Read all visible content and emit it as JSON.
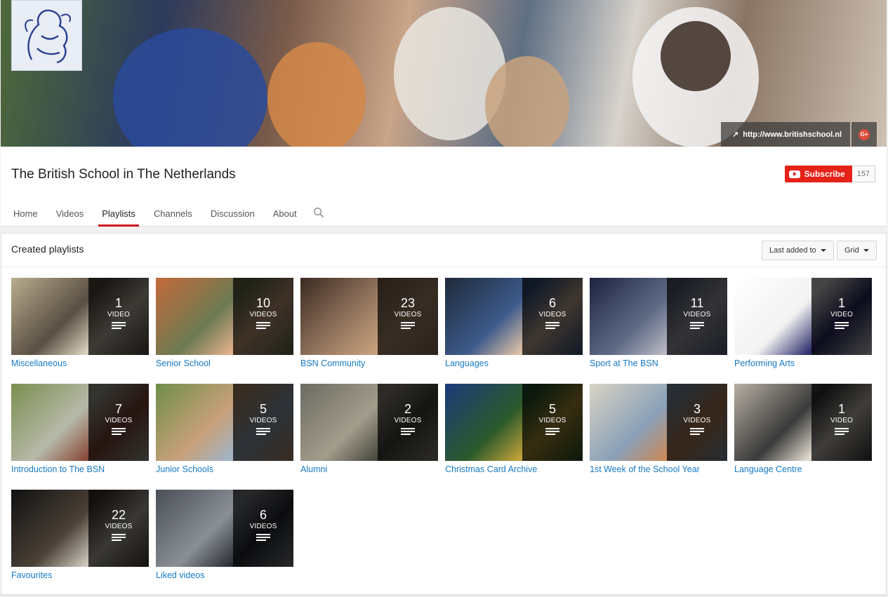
{
  "banner": {
    "website_link": "http://www.britishschool.nl",
    "social_icon": "google-plus-icon",
    "logo_icon": "lion-crest-logo"
  },
  "channel": {
    "title": "The British School in The Netherlands",
    "subscribe_label": "Subscribe",
    "subscriber_count": "157"
  },
  "tabs": [
    "Home",
    "Videos",
    "Playlists",
    "Channels",
    "Discussion",
    "About"
  ],
  "active_tab": "Playlists",
  "section": {
    "title": "Created playlists",
    "sort_label": "Last added to",
    "view_label": "Grid"
  },
  "playlists": [
    {
      "title": "Miscellaneous",
      "count": "1",
      "label": "VIDEO",
      "colors": [
        "#b9ad8e",
        "#5a4f43",
        "#d9d2bf"
      ]
    },
    {
      "title": "Senior School",
      "count": "10",
      "label": "VIDEOS",
      "colors": [
        "#c46a3a",
        "#6d7a52",
        "#e3b18d"
      ]
    },
    {
      "title": "BSN Community",
      "count": "23",
      "label": "VIDEOS",
      "colors": [
        "#3b2a22",
        "#9a7b62",
        "#c8a17e"
      ]
    },
    {
      "title": "Languages",
      "count": "6",
      "label": "VIDEOS",
      "colors": [
        "#1f2a3a",
        "#3c5a8a",
        "#e0c2a7"
      ]
    },
    {
      "title": "Sport at The BSN",
      "count": "11",
      "label": "VIDEOS",
      "colors": [
        "#1d2342",
        "#5f6b85",
        "#b8b8c4"
      ]
    },
    {
      "title": "Performing Arts",
      "count": "1",
      "label": "VIDEO",
      "colors": [
        "#ffffff",
        "#f2f2f2",
        "#2b2b6a"
      ]
    },
    {
      "title": "Introduction to The BSN",
      "count": "7",
      "label": "VIDEOS",
      "colors": [
        "#7b8f4e",
        "#b7b9aa",
        "#8a4a3a"
      ]
    },
    {
      "title": "Junior Schools",
      "count": "5",
      "label": "VIDEOS",
      "colors": [
        "#6f8e4a",
        "#c9a07a",
        "#9fb4c8"
      ]
    },
    {
      "title": "Alumni",
      "count": "2",
      "label": "VIDEOS",
      "colors": [
        "#6b6b60",
        "#a39c8c",
        "#4a4a40"
      ]
    },
    {
      "title": "Christmas Card Archive",
      "count": "5",
      "label": "VIDEOS",
      "colors": [
        "#1d3a7a",
        "#2b5a2b",
        "#c4a23a"
      ]
    },
    {
      "title": "1st Week of the School Year",
      "count": "3",
      "label": "VIDEOS",
      "colors": [
        "#d9d4c4",
        "#8aa0b8",
        "#c98a5a"
      ]
    },
    {
      "title": "Language Centre",
      "count": "1",
      "label": "VIDEO",
      "colors": [
        "#b8b0a4",
        "#3a3a3a",
        "#e4ddd2"
      ]
    },
    {
      "title": "Favourites",
      "count": "22",
      "label": "VIDEOS",
      "colors": [
        "#111111",
        "#4a4036",
        "#cfc9bd"
      ]
    },
    {
      "title": "Liked videos",
      "count": "6",
      "label": "VIDEOS",
      "colors": [
        "#4a4e55",
        "#8a8f96",
        "#2a2e36"
      ]
    }
  ]
}
